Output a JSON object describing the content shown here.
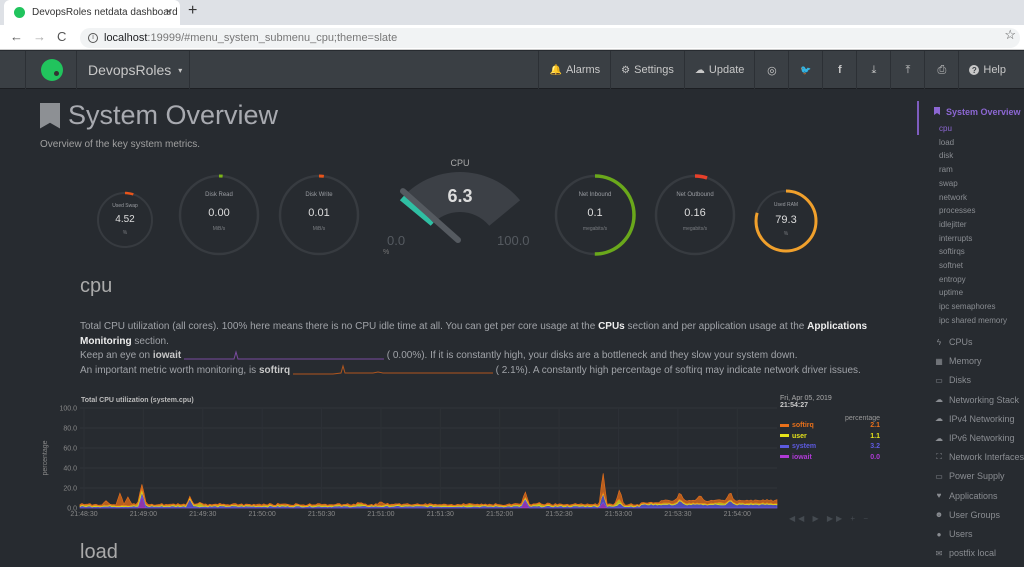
{
  "browser": {
    "tab_title": "DevopsRoles netdata dashboard",
    "tab_close": "×",
    "new_tab": "+",
    "url_host": "localhost",
    "url_rest": ":19999/#menu_system_submenu_cpu;theme=slate",
    "back": "←",
    "forward": "→",
    "reload": "C",
    "bookmark_star": "☆"
  },
  "navbar": {
    "brand": "DevopsRoles",
    "brand_caret": "▾",
    "buttons": [
      {
        "label": "Alarms",
        "icon": "🔔"
      },
      {
        "label": "Settings",
        "icon": "⚙"
      },
      {
        "label": "Update",
        "icon": "☁"
      }
    ],
    "icon_buttons": [
      {
        "name": "github",
        "glyph": "◎"
      },
      {
        "name": "twitter",
        "glyph": "🐦"
      },
      {
        "name": "facebook",
        "glyph": "f"
      },
      {
        "name": "download",
        "glyph": "⤓"
      },
      {
        "name": "upload",
        "glyph": "⤒"
      },
      {
        "name": "print",
        "glyph": "⎙"
      }
    ],
    "help": {
      "label": "Help",
      "icon": "?"
    }
  },
  "page": {
    "title": "System Overview",
    "subtitle": "Overview of the key system metrics."
  },
  "gauges": [
    {
      "label": "Used Swap",
      "value": "4.52",
      "unit": "%",
      "fraction": 0.05,
      "color": "#e8541a"
    },
    {
      "label": "Disk Read",
      "value": "0.00",
      "unit": "MiB/s",
      "fraction": 0.0,
      "color": "#7cb518"
    },
    {
      "label": "Disk Write",
      "value": "0.01",
      "unit": "MiB/s",
      "fraction": 0.02,
      "color": "#e8541a"
    },
    {
      "label": "Net Inbound",
      "value": "0.1",
      "unit": "megabits/s",
      "fraction": 0.5,
      "color": "#6aa81b"
    },
    {
      "label": "Net Outbound",
      "value": "0.16",
      "unit": "megabits/s",
      "fraction": 0.05,
      "color": "#e8402a"
    },
    {
      "label": "Used RAM",
      "value": "79.3",
      "unit": "%",
      "fraction": 0.793,
      "color": "#f0a02c"
    }
  ],
  "cpu_gauge": {
    "label": "CPU",
    "value": "6.3",
    "min": "0.0",
    "max": "100.0",
    "unit": "%",
    "fraction": 0.063,
    "color": "#2fbfa3"
  },
  "cpu_section": {
    "heading": "cpu",
    "p1_a": "Total CPU utilization (all cores). 100% here means there is no CPU idle time at all. You can get per core usage at the ",
    "p1_b": "CPUs",
    "p1_c": " section and per application usage at the ",
    "p1_d": "Applications Monitoring",
    "p1_e": " section.",
    "p2_a": "Keep an eye on ",
    "p2_b": "iowait",
    "p2_c": "(      0.00%). If it is constantly high, your disks are a bottleneck and they slow your system down.",
    "p3_a": "An important metric worth monitoring, is ",
    "p3_b": "softirq",
    "p3_c": "(       2.1%). A constantly high percentage of softirq may indicate network driver issues."
  },
  "chart_data": {
    "type": "area",
    "title": "Total CPU utilization (system.cpu)",
    "ylabel": "percentage",
    "xlabel": "",
    "ylim": [
      0,
      100
    ],
    "yticks": [
      "100.0",
      "80.0",
      "60.0",
      "40.0",
      "20.0",
      "0.0"
    ],
    "xticks": [
      "21:48:30",
      "21:49:00",
      "21:49:30",
      "21:50:00",
      "21:50:30",
      "21:51:00",
      "21:51:30",
      "21:52:00",
      "21:52:30",
      "21:53:00",
      "21:53:30",
      "21:54:00"
    ],
    "x_range": [
      "21:48:20",
      "21:54:27"
    ],
    "legend_date": "Fri, Apr 05, 2019",
    "legend_time": "21:54:27",
    "legend_unit": "percentage",
    "series": [
      {
        "name": "softirq",
        "color": "#e8701a",
        "latest": "2.1",
        "spikes": [
          [
            26,
            4
          ],
          [
            40,
            12
          ],
          [
            48,
            8
          ],
          [
            63,
            5
          ],
          [
            301,
            3
          ],
          [
            445,
            5
          ],
          [
            523,
            20
          ],
          [
            540,
            10
          ],
          [
            600,
            4
          ],
          [
            620,
            6
          ],
          [
            650,
            5
          ],
          [
            700,
            3
          ]
        ]
      },
      {
        "name": "user",
        "color": "#e5e21a",
        "latest": "1.1",
        "spikes": [
          [
            60,
            4
          ],
          [
            120,
            3
          ],
          [
            280,
            2
          ],
          [
            390,
            2
          ],
          [
            460,
            2
          ],
          [
            538,
            4
          ],
          [
            640,
            2
          ]
        ]
      },
      {
        "name": "system",
        "color": "#5d5ae0",
        "latest": "3.2",
        "spikes": [
          [
            63,
            3
          ],
          [
            110,
            8
          ],
          [
            523,
            8
          ],
          [
            540,
            4
          ],
          [
            600,
            4
          ],
          [
            650,
            4
          ]
        ]
      },
      {
        "name": "iowait",
        "color": "#b03ad6",
        "latest": "0.0",
        "spikes": [
          [
            62,
            12
          ],
          [
            445,
            8
          ],
          [
            523,
            6
          ]
        ]
      }
    ],
    "controls": "◀◀ ▶ ▶▶ + −"
  },
  "load_section": {
    "heading": "load"
  },
  "sidebar": {
    "section": "System Overview",
    "subitems": [
      "cpu",
      "load",
      "disk",
      "ram",
      "swap",
      "network",
      "processes",
      "idlejitter",
      "interrupts",
      "softirqs",
      "softnet",
      "entropy",
      "uptime",
      "ipc semaphores",
      "ipc shared memory"
    ],
    "items": [
      {
        "label": "CPUs",
        "icon": "ϟ"
      },
      {
        "label": "Memory",
        "icon": "▦"
      },
      {
        "label": "Disks",
        "icon": "▭"
      },
      {
        "label": "Networking Stack",
        "icon": "☁"
      },
      {
        "label": "IPv4 Networking",
        "icon": "☁"
      },
      {
        "label": "IPv6 Networking",
        "icon": "☁"
      },
      {
        "label": "Network Interfaces",
        "icon": "⛶"
      },
      {
        "label": "Power Supply",
        "icon": "▭"
      },
      {
        "label": "Applications",
        "icon": "♥"
      },
      {
        "label": "User Groups",
        "icon": "☻"
      },
      {
        "label": "Users",
        "icon": "●"
      },
      {
        "label": "postfix local",
        "icon": "✉"
      }
    ]
  }
}
